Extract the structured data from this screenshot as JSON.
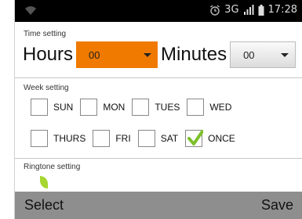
{
  "status_bar": {
    "network": "3G",
    "time": "17:28",
    "icons": [
      "wifi-icon",
      "alarm-icon",
      "signal-icon",
      "battery-icon"
    ]
  },
  "time_setting": {
    "label": "Time setting",
    "hours_label": "Hours",
    "hours_value": "00",
    "minutes_label": "Minutes",
    "minutes_value": "00"
  },
  "week_setting": {
    "label": "Week setting",
    "days": [
      {
        "label": "SUN",
        "checked": false
      },
      {
        "label": "MON",
        "checked": false
      },
      {
        "label": "TUES",
        "checked": false
      },
      {
        "label": "WED",
        "checked": false
      },
      {
        "label": "THURS",
        "checked": false
      },
      {
        "label": "FRI",
        "checked": false
      },
      {
        "label": "SAT",
        "checked": false
      },
      {
        "label": "ONCE",
        "checked": true
      }
    ]
  },
  "ringtone_setting": {
    "label": "Ringtone setting"
  },
  "bottom_bar": {
    "left_label": "Select",
    "right_label": "Save"
  },
  "colors": {
    "accent": "#f07a00",
    "check": "#7cc02a",
    "bottom_bar": "#8e8e8e"
  }
}
